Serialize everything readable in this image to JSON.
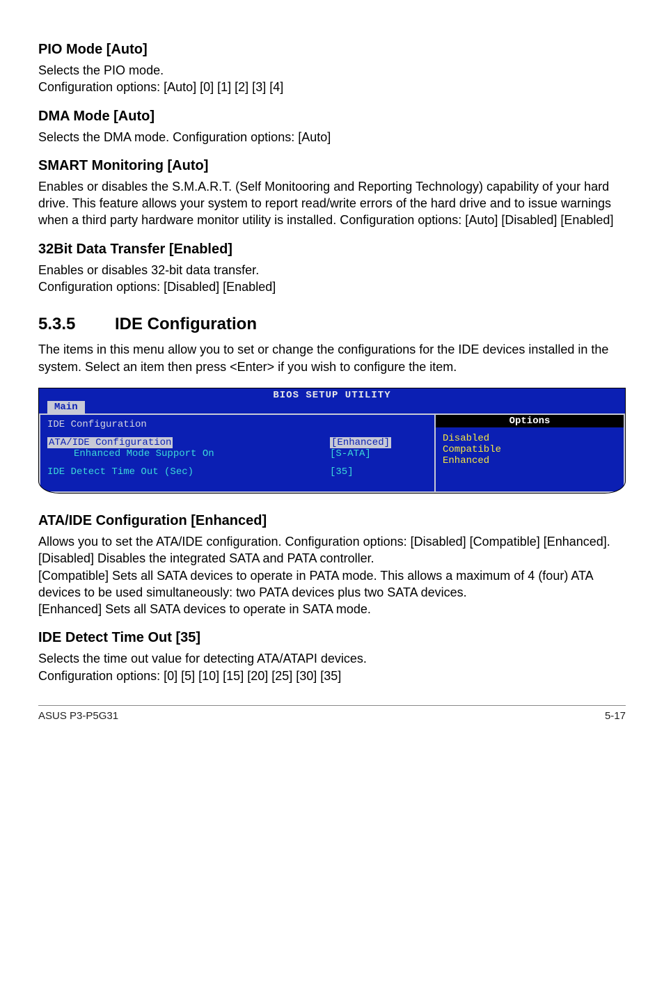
{
  "s1": {
    "h": "PIO Mode [Auto]",
    "p1": "Selects the PIO mode.",
    "p2": "Configuration options: [Auto] [0] [1] [2] [3] [4]"
  },
  "s2": {
    "h": "DMA Mode [Auto]",
    "p": "Selects the DMA mode. Configuration options: [Auto]"
  },
  "s3": {
    "h": "SMART Monitoring [Auto]",
    "p": "Enables or disables the S.M.A.R.T. (Self Monitooring and Reporting Technology) capability of your hard drive. This feature allows your system to report read/write errors of the hard drive and to issue warnings when a third party hardware monitor utility is installed. Configuration options: [Auto] [Disabled] [Enabled]"
  },
  "s4": {
    "h": "32Bit Data Transfer [Enabled]",
    "p1": "Enables or disables 32-bit data transfer.",
    "p2": "Configuration options: [Disabled] [Enabled]"
  },
  "sec535": {
    "num": "5.3.5",
    "title": "IDE Configuration",
    "intro": "The items in this menu allow you to set or change the configurations for the IDE devices installed in the system. Select an item then press <Enter> if you wish to configure the item."
  },
  "bios": {
    "title": "BIOS SETUP UTILITY",
    "tab": "Main",
    "left_header": "IDE Configuration",
    "row1_label": "ATA/IDE Configuration",
    "row1_value": "[Enhanced]",
    "row2_label": "Enhanced Mode Support On",
    "row2_value": "[S-ATA]",
    "row3_label": "IDE Detect Time Out (Sec)",
    "row3_value": "[35]",
    "right_header": "Options",
    "opt1": "Disabled",
    "opt2": "Compatible",
    "opt3": "Enhanced"
  },
  "s5": {
    "h": "ATA/IDE Configuration [Enhanced]",
    "p1": "Allows you to set the ATA/IDE configuration. Configuration options: [Disabled] [Compatible] [Enhanced].",
    "p2": "[Disabled] Disables the integrated SATA and PATA controller.",
    "p3": "[Compatible] Sets all SATA devices to operate in PATA mode. This allows a maximum of 4 (four) ATA devices to be used simultaneously: two PATA devices plus two SATA devices.",
    "p4": "[Enhanced] Sets all SATA devices to operate in SATA mode."
  },
  "s6": {
    "h": "IDE Detect Time Out [35]",
    "p1": "Selects the time out value for detecting ATA/ATAPI devices.",
    "p2": "Configuration options: [0] [5] [10] [15] [20] [25] [30] [35]"
  },
  "footer": {
    "left": "ASUS P3-P5G31",
    "right": "5-17"
  }
}
